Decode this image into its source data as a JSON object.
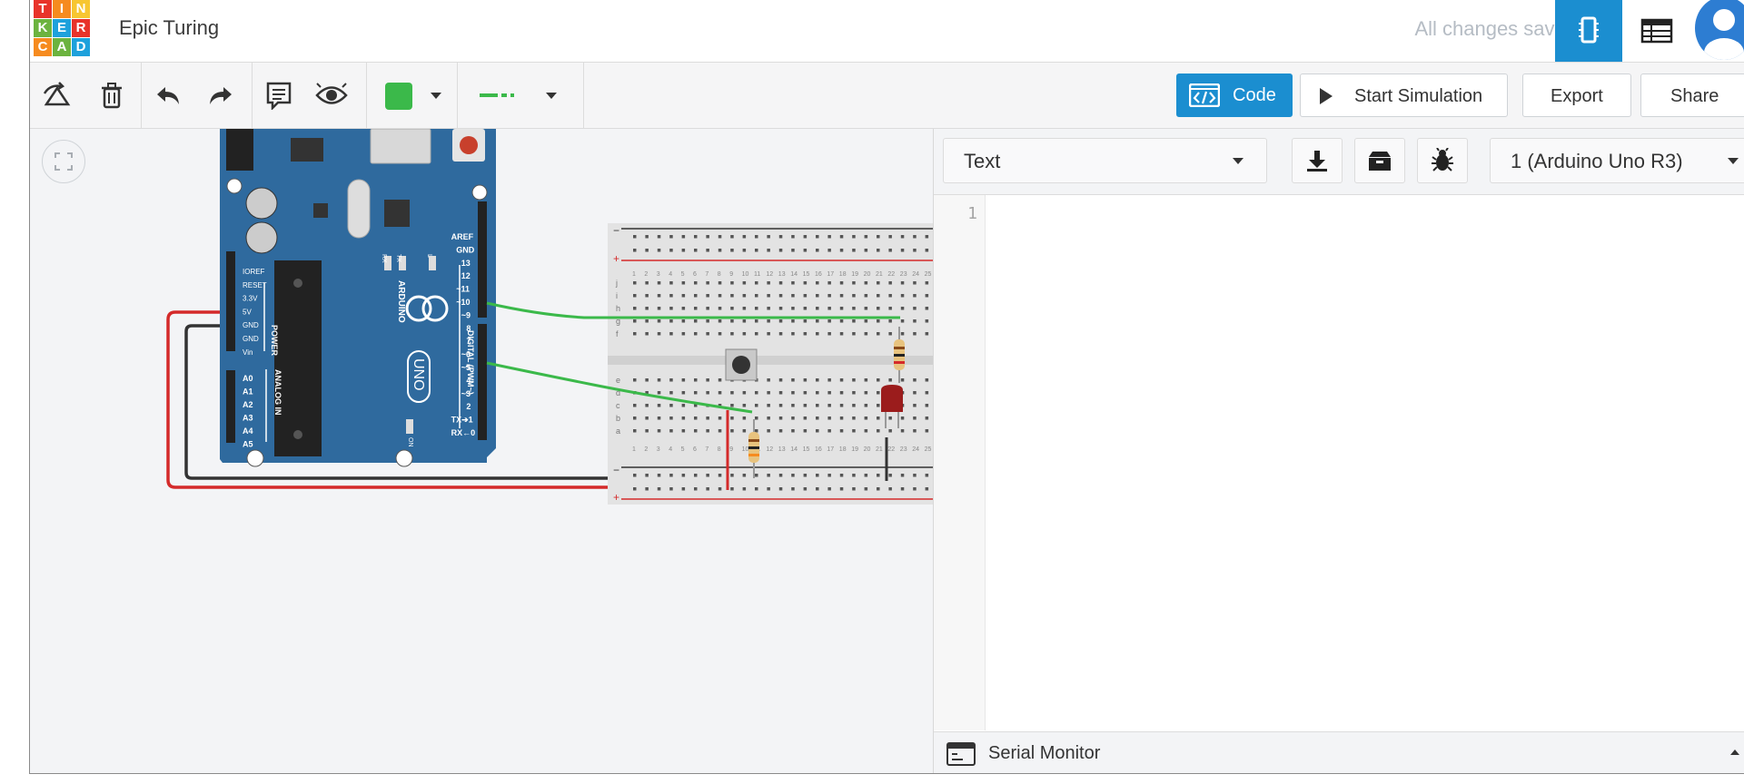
{
  "header": {
    "logo_letters": [
      "T",
      "I",
      "N",
      "K",
      "E",
      "R",
      "C",
      "A",
      "D"
    ],
    "logo_colors": [
      "#e8332a",
      "#f68b1f",
      "#f7c631",
      "#6cb33f",
      "#1ea1dc",
      "#e8332a",
      "#f68b1f",
      "#6cb33f",
      "#1ea1dc"
    ],
    "title": "Epic Turing",
    "save_status": "All changes saved"
  },
  "toolbar": {
    "icons": [
      "rotate-icon",
      "delete-icon",
      "undo-icon",
      "redo-icon",
      "notes-icon",
      "visibility-icon"
    ],
    "color_value": "#3bb94a",
    "code_label": "Code",
    "simulate_label": "Start Simulation",
    "export_label": "Export",
    "share_label": "Share"
  },
  "code_panel": {
    "mode": "Text",
    "device": "1 (Arduino Uno R3)",
    "line_numbers": [
      "1"
    ],
    "serial_monitor_label": "Serial Monitor"
  },
  "circuit": {
    "arduino": {
      "brand": "ARDUINO",
      "model": "UNO",
      "power_pins": [
        "IOREF",
        "RESET",
        "3.3V",
        "5V",
        "GND",
        "GND",
        "Vin"
      ],
      "power_label": "POWER",
      "analog_pins": [
        "A0",
        "A1",
        "A2",
        "A3",
        "A4",
        "A5"
      ],
      "analog_label": "ANALOG IN",
      "digital_pins": [
        "AREF",
        "GND",
        "13",
        "12",
        "~11",
        "~10",
        "~9",
        "8",
        "7",
        "~6",
        "~5",
        "4",
        "~3",
        "2",
        "TX➔1",
        "RX←0"
      ],
      "digital_label": "DIGITAL (PWM~)",
      "led_labels": [
        "RX",
        "TX",
        "L"
      ],
      "on_label": "ON"
    },
    "breadboard": {
      "top_rail_signs": [
        "−",
        "+"
      ],
      "bottom_rail_signs": [
        "−",
        "+"
      ],
      "row_letters_top": [
        "j",
        "i",
        "h",
        "g",
        "f"
      ],
      "row_letters_bottom": [
        "e",
        "d",
        "c",
        "b",
        "a"
      ],
      "column_count": 25
    },
    "colors": {
      "board": "#2f6a9e",
      "wire_green": "#3bb94a",
      "wire_red": "#d42a2a",
      "wire_black": "#333333"
    }
  }
}
